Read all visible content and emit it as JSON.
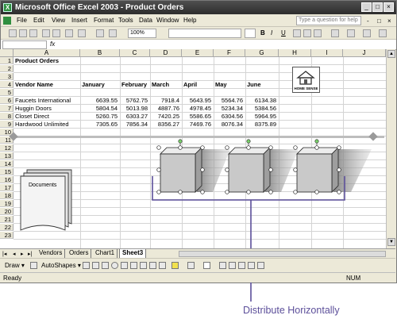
{
  "window": {
    "title": "Microsoft Office Excel 2003 - Product Orders",
    "app_icon_letter": "X",
    "buttons": [
      "_",
      "□",
      "×"
    ]
  },
  "menu": {
    "items": [
      "File",
      "Edit",
      "View",
      "Insert",
      "Format",
      "Tools",
      "Data",
      "Window",
      "Help"
    ],
    "help_placeholder": "Type a question for help",
    "doc_controls": [
      "-",
      "□",
      "×"
    ]
  },
  "toolbar": {
    "zoom": "100%",
    "format_buttons": [
      "B",
      "I",
      "U"
    ]
  },
  "columns": [
    "A",
    "B",
    "C",
    "D",
    "E",
    "F",
    "G",
    "H",
    "I",
    "J"
  ],
  "rows": [
    "1",
    "2",
    "3",
    "4",
    "5",
    "6",
    "7",
    "8",
    "9",
    "10",
    "11",
    "12",
    "13",
    "14",
    "15",
    "16",
    "17",
    "18",
    "19",
    "20",
    "21",
    "22",
    "23"
  ],
  "sheet": {
    "title": "Product Orders",
    "header_label": "Vendor Name",
    "months": [
      "January",
      "February",
      "March",
      "April",
      "May",
      "June"
    ],
    "vendors": [
      {
        "name": "Faucets International",
        "values": [
          "6639.55",
          "5762.75",
          "7918.4",
          "5643.95",
          "5564.76",
          "6134.38"
        ]
      },
      {
        "name": "Huggin Doors",
        "values": [
          "5804.54",
          "5013.98",
          "4887.76",
          "4978.45",
          "5234.34",
          "5384.56"
        ]
      },
      {
        "name": "Closet Direct",
        "values": [
          "5260.75",
          "6303.27",
          "7420.25",
          "5586.65",
          "6304.56",
          "5964.95"
        ]
      },
      {
        "name": "Hardwood Unlimited",
        "values": [
          "7305.65",
          "7856.34",
          "8356.27",
          "7469.76",
          "8076.34",
          "8375.89"
        ]
      }
    ],
    "logo_text": "HOME SENSE",
    "documents_label": "Documents"
  },
  "tabs": {
    "nav": [
      "|◂",
      "◂",
      "▸",
      "▸|"
    ],
    "sheets": [
      "Vendors",
      "Orders",
      "Chart1",
      "Sheet3"
    ],
    "active": "Sheet3"
  },
  "drawbar": {
    "draw_label": "Draw ▾",
    "autoshapes_label": "AutoShapes ▾"
  },
  "status": {
    "left": "Ready",
    "right": "NUM"
  },
  "callout": "Distribute Horizontally",
  "colors": {
    "titlebar": "#3a3a3a",
    "chrome": "#ece9d8",
    "callout": "#5c4f9a"
  }
}
